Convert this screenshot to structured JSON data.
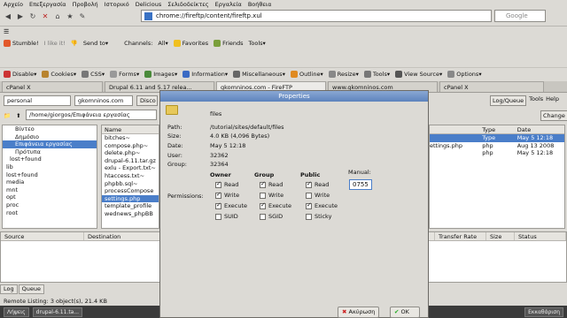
{
  "menu": [
    "Αρχείο",
    "Επεξεργασία",
    "Προβολή",
    "Ιστορικό",
    "Delicious",
    "Σελιδοδείκτες",
    "Εργαλεία",
    "Βοήθεια"
  ],
  "url": "chrome://fireftp/content/fireftp.xul",
  "search_placeholder": "Google",
  "toolbar2": {
    "stumble": "Stumble!",
    "like": "I like it!",
    "sendto": "Send to",
    "channels": "Channels:",
    "all": "All",
    "favorites": "Favorites",
    "friends": "Friends",
    "tools": "Tools"
  },
  "webdev": [
    "Disable",
    "Cookies",
    "CSS",
    "Forms",
    "Images",
    "Information",
    "Miscellaneous",
    "Outline",
    "Resize",
    "Tools",
    "View Source",
    "Options"
  ],
  "tabs": [
    "cPanel X",
    "Drupal 6.11 and 5.17 relea...",
    "gkomninos.com - FireFTP",
    "www.gkomninos.com",
    "cPanel X"
  ],
  "ftp": {
    "account": "personal",
    "server": "gkomninos.com",
    "disconnect": "Disco",
    "logqueue": "Log/Queue",
    "tools": "Tools",
    "help": "Help",
    "change": "Change"
  },
  "local_path": "/home/giorgos/Επιφάνεια εργασίας",
  "tree": [
    "Βίντεο",
    "Δημόσιο",
    "Επιφάνεια εργασίας",
    "Πρότυπα",
    "lost+found",
    "lib",
    "lost+found",
    "media",
    "mnt",
    "opt",
    "proc",
    "root"
  ],
  "local_files": {
    "header": "Name",
    "items": [
      "bitches~",
      "compose.php~",
      "delete.php~",
      "drupal-6.11.tar.gz",
      "exlu - Export.txt~",
      "htaccess.txt~",
      "phpbb.sql~",
      "processCompose",
      "settings.php",
      "template_profile",
      "wednews_phpBB"
    ]
  },
  "remote_files": {
    "headers": [
      "Type",
      "Date"
    ],
    "rows": [
      [
        "",
        "Type",
        "May 5 12:18"
      ],
      [
        "ettings.php",
        "php",
        "Aug 13 2008"
      ],
      [
        "",
        "php",
        "May 5 12:18"
      ]
    ]
  },
  "queue": {
    "headers": [
      "Source",
      "Destination",
      "Transfer Rate",
      "Size",
      "Status"
    ],
    "tabs": [
      "Log",
      "Queue"
    ]
  },
  "status": "Remote Listing: 3 object(s), 21.4 KB",
  "taskbar": [
    "Λήψεις",
    "drupal-6.11.ta..."
  ],
  "taskbar_right": "Εκκαθάριση",
  "dialog": {
    "title": "Properties",
    "name": "files",
    "path_label": "Path:",
    "path": "/tutorial/sites/default/files",
    "size_label": "Size:",
    "size": "4.0 KB  (4,096 Bytes)",
    "date_label": "Date:",
    "date": "May 5 12:18",
    "user_label": "User:",
    "user": "32362",
    "group_label": "Group:",
    "group": "32364",
    "owner_h": "Owner",
    "group_h": "Group",
    "public_h": "Public",
    "perm_label": "Permissions:",
    "read": "Read",
    "write": "Write",
    "execute": "Execute",
    "suid": "SUID",
    "sgid": "SGID",
    "sticky": "Sticky",
    "manual_label": "Manual:",
    "manual_value": "0755",
    "cancel": "Ακύρωση",
    "ok": "OK"
  }
}
